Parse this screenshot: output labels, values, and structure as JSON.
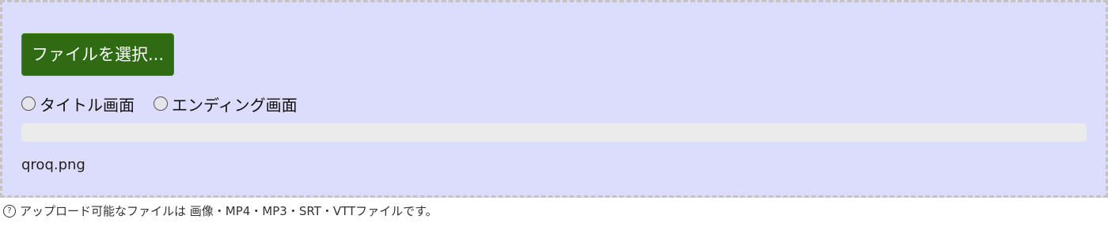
{
  "upload": {
    "select_button_label": "ファイルを選択...",
    "radio_options": [
      {
        "label": "タイトル画面",
        "selected": false
      },
      {
        "label": "エンディング画面",
        "selected": false
      }
    ],
    "progress": 0,
    "file_name": "qroq.png"
  },
  "help": {
    "icon": "question-circle-icon",
    "text": "アップロード可能なファイルは 画像・MP4・MP3・SRT・VTTファイルです。"
  },
  "colors": {
    "zone_background": "#dcdcfc",
    "zone_border": "#c4c4c4",
    "button_background": "#2e6b12"
  }
}
